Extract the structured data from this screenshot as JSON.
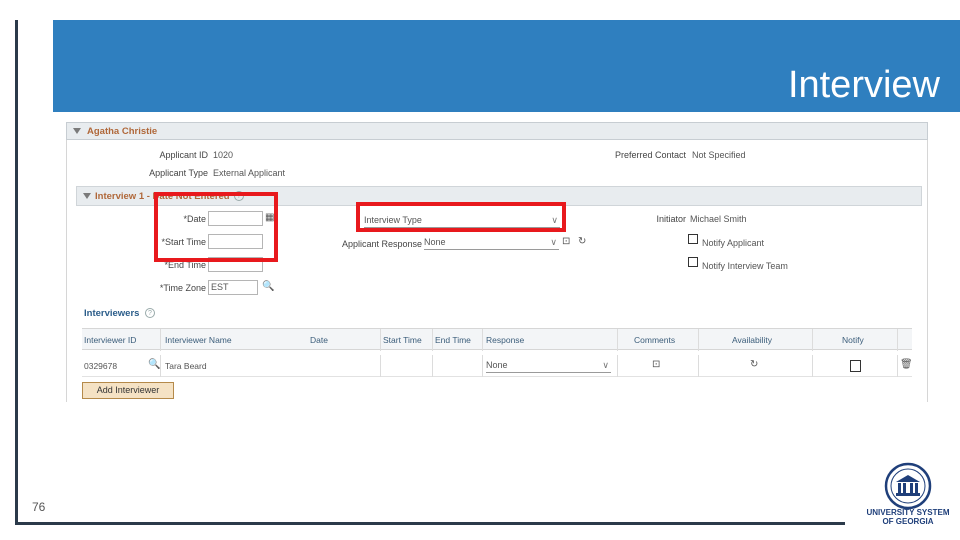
{
  "slide": {
    "title": "Interview",
    "page_number": "76"
  },
  "applicant": {
    "section_title": "Agatha Christie",
    "applicant_id_label": "Applicant ID",
    "applicant_id_value": "1020",
    "applicant_type_label": "Applicant Type",
    "applicant_type_value": "External Applicant",
    "preferred_contact_label": "Preferred Contact",
    "preferred_contact_value": "Not Specified"
  },
  "interview": {
    "section_title": "Interview 1 - Date Not Entered",
    "date_label": "*Date",
    "start_time_label": "*Start Time",
    "end_time_label": "*End Time",
    "time_zone_label": "*Time Zone",
    "time_zone_value": "EST",
    "interview_type_label": "Interview Type",
    "applicant_response_label": "Applicant Response",
    "applicant_response_value": "None",
    "initiator_label": "Initiator",
    "initiator_value": "Michael Smith",
    "notify_applicant_label": "Notify Applicant",
    "notify_team_label": "Notify Interview Team"
  },
  "interviewers": {
    "title": "Interviewers",
    "columns": [
      "Interviewer ID",
      "Interviewer Name",
      "Date",
      "Start Time",
      "End Time",
      "Response",
      "Comments",
      "Availability",
      "Notify"
    ],
    "rows": [
      {
        "id": "0329678",
        "name": "Tara Beard",
        "response": "None"
      }
    ],
    "add_button": "Add Interviewer"
  },
  "logo": {
    "line1": "UNIVERSITY SYSTEM",
    "line2": "OF GEORGIA"
  },
  "colors": {
    "header_band": "#2f7fbf",
    "highlight": "#e8191d",
    "section_title": "#b0683a"
  }
}
